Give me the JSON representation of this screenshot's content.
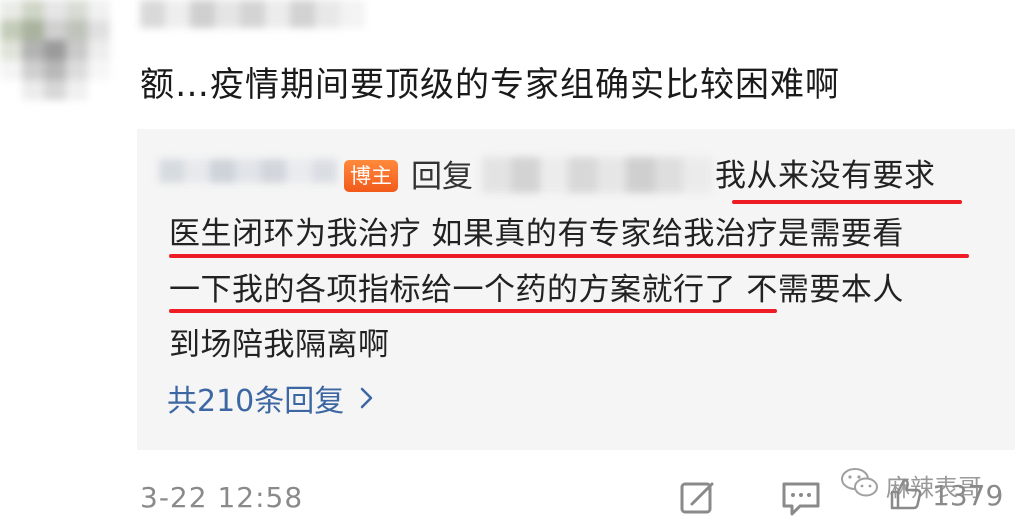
{
  "comment": {
    "text": "额…疫情期间要顶级的专家组确实比较困难啊",
    "timestamp": "3-22 12:58"
  },
  "reply": {
    "badge": "博主",
    "reply_label": "回复",
    "lines": [
      "我从来没有要求",
      "医生闭环为我治疗 如果真的有专家给我治疗是需要看",
      "一下我的各项指标给一个药的方案就行了 不需要本人",
      "到场陪我隔离啊"
    ],
    "total_replies": "共210条回复"
  },
  "watermark": {
    "text": "麻辣表哥"
  },
  "actions": {
    "like_count": "1379"
  },
  "icons": {
    "chevron": "chevron-right-icon",
    "edit": "edit-icon",
    "comment": "comment-icon",
    "wechat": "wechat-icon",
    "like": "thumbs-up-icon"
  },
  "colors": {
    "badge": "#f25a1a",
    "link": "#3d67a3",
    "underline": "#ee1c25",
    "reply_bg": "#f5f5f5"
  }
}
